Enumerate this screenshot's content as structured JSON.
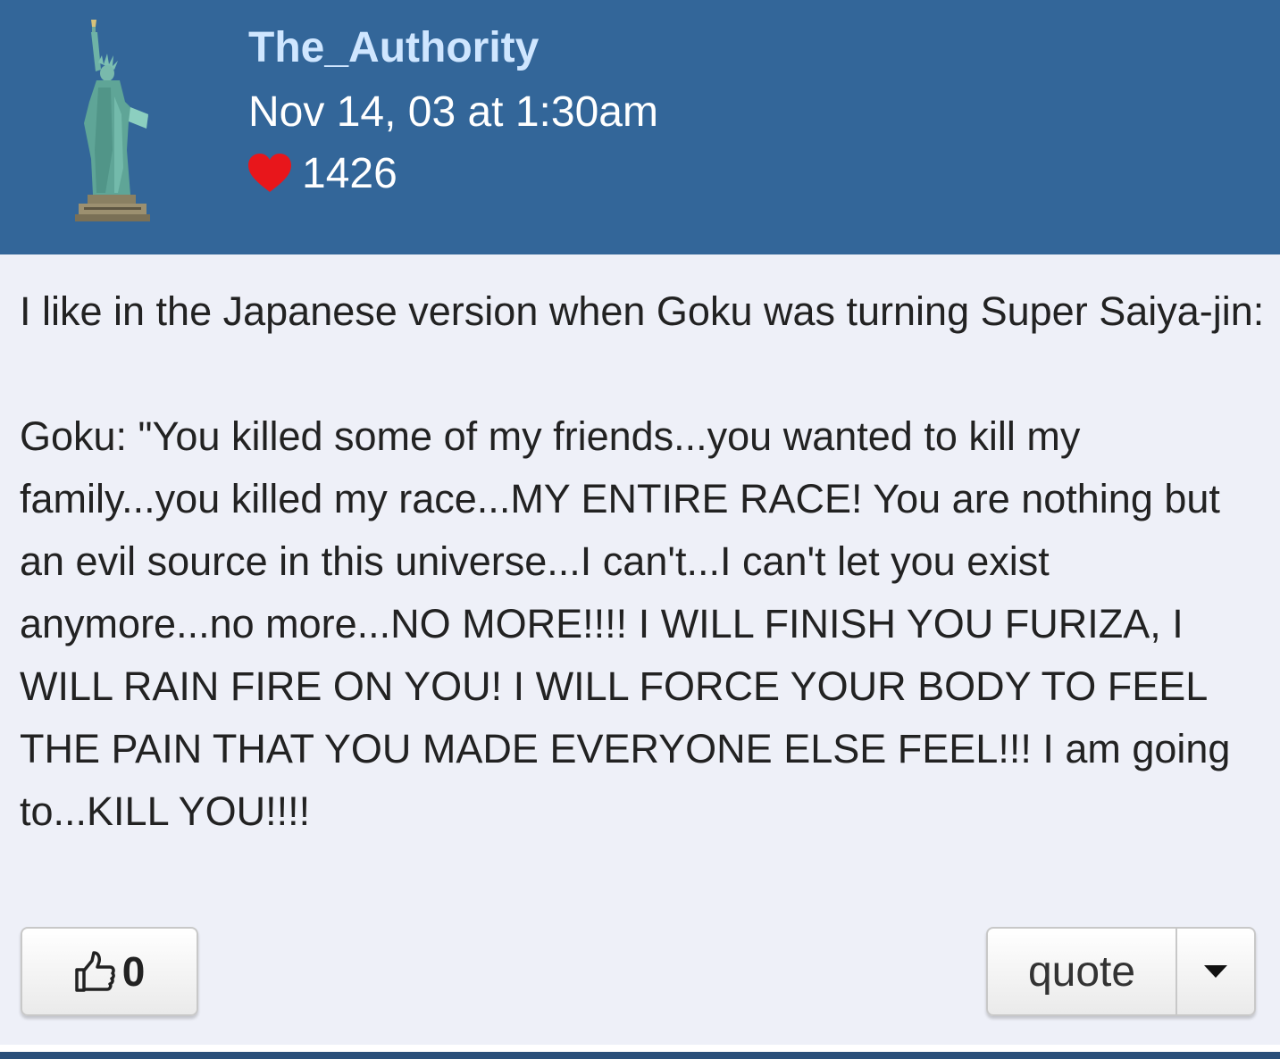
{
  "author": {
    "username": "The_Authority",
    "avatar_icon": "statue-of-liberty-icon"
  },
  "post": {
    "date": "Nov 14, 03 at 1:30am",
    "reputation": "1426",
    "paragraphs": [
      "I like in the Japanese version when Goku was turning Super Saiya-jin:",
      "Goku: \"You killed some of my friends...you wanted to kill my family...you killed my race...MY ENTIRE RACE! You are nothing but an evil source in this universe...I can't...I can't let you exist anymore...no more...NO MORE!!!! I WILL FINISH YOU FURIZA, I WILL RAIN FIRE ON YOU! I WILL FORCE YOUR BODY TO FEEL THE PAIN THAT YOU MADE EVERYONE ELSE FEEL!!! I am going to...KILL YOU!!!!"
    ]
  },
  "actions": {
    "like_count": "0",
    "like_icon": "thumbs-up-icon",
    "quote_label": "quote",
    "dropdown_icon": "caret-down-icon"
  },
  "colors": {
    "header_bg": "#336699",
    "username": "#cfe6ff",
    "body_bg": "#eef0f8",
    "heart": "#e8161b"
  }
}
